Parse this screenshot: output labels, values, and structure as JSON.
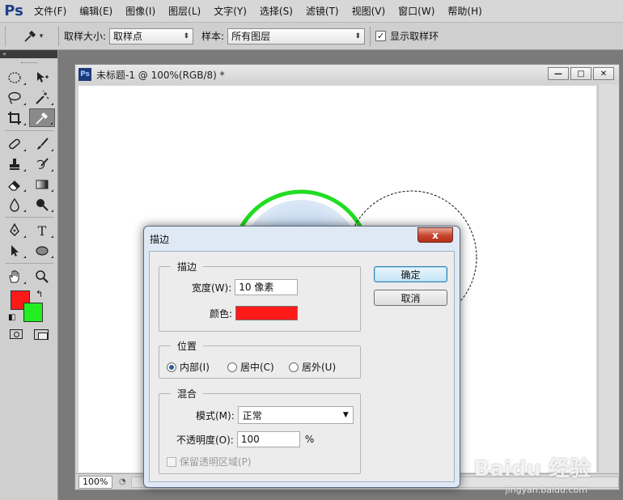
{
  "app": {
    "logo": "Ps"
  },
  "menu": [
    "文件(F)",
    "编辑(E)",
    "图像(I)",
    "图层(L)",
    "文字(Y)",
    "选择(S)",
    "滤镜(T)",
    "视图(V)",
    "窗口(W)",
    "帮助(H)"
  ],
  "options": {
    "sample_size_label": "取样大小:",
    "sample_size_value": "取样点",
    "sample_label": "样本:",
    "sample_value": "所有图层",
    "show_ring_label": "显示取样环",
    "show_ring_checked": true
  },
  "toolbox": {
    "foreground_color": "#ff1a1a",
    "background_color": "#22ee22",
    "active_tool": "eyedropper"
  },
  "document": {
    "icon": "Ps",
    "title": "未标题-1 @ 100%(RGB/8) *",
    "zoom": "100%",
    "circle_color": "#22dd22"
  },
  "dialog": {
    "title": "描边",
    "close_label": "x",
    "stroke_group": "描边",
    "width_label": "宽度(W):",
    "width_value": "10 像素",
    "color_label": "颜色:",
    "stroke_color": "#ff1a1a",
    "position_group": "位置",
    "pos_inside": "内部(I)",
    "pos_center": "居中(C)",
    "pos_outside": "居外(U)",
    "position_selected": "inside",
    "blend_group": "混合",
    "mode_label": "模式(M):",
    "mode_value": "正常",
    "opacity_label": "不透明度(O):",
    "opacity_value": "100",
    "opacity_unit": "%",
    "preserve_label": "保留透明区域(P)",
    "ok_label": "确定",
    "cancel_label": "取消"
  },
  "watermark": {
    "text": "Baidu 经验",
    "sub": "jingyan.baidu.com"
  }
}
